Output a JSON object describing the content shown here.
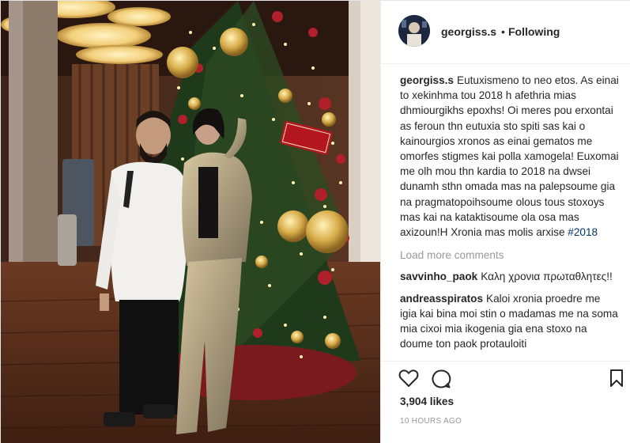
{
  "post": {
    "username": "georgiss.s",
    "follow_dot": "•",
    "follow_status": "Following"
  },
  "caption": {
    "username": "georgiss.s",
    "text": "Eutuxismeno to neo etos. As einai to xekinhma tou 2018 h afethria mias dhmiourgikhs epoxhs! Oi meres pou erxontai as feroun thn eutuxia sto spiti sas kai o kainourgios xronos as einai gematos me omorfes stigmes kai polla xamogela! Euxomai me olh mou thn kardia to 2018 na dwsei dunamh sthn omada mas na palepsoume gia na pragmatopoihsoume olous tous stoxoys mas kai na kataktisoume ola osa mas axizoun!H Xronia mas molis arxise",
    "hashtag": "#2018"
  },
  "load_more": "Load more comments",
  "comments": [
    {
      "username": "savvinho_paok",
      "text": "Καλη χρονια πρωταθλητες!!"
    },
    {
      "username": "andreasspiratos",
      "text": "Kaloi xronia proedre me igia kai bina moi stin o madamas me na soma mia cixoi mia ikogenia gia ena stoxo na doume ton paok protauloiti"
    }
  ],
  "likes": "3,904 likes",
  "timestamp": "10 HOURS AGO",
  "icons": {
    "like": "heart-icon",
    "comment": "comment-icon",
    "save": "bookmark-icon"
  },
  "colors": {
    "text": "#262626",
    "muted": "#999999",
    "hashtag": "#003569",
    "border": "#efefef"
  }
}
